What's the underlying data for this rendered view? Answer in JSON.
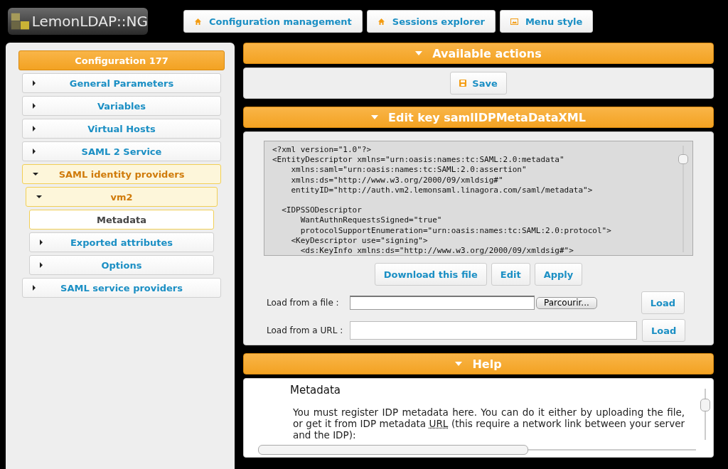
{
  "logo": {
    "text": "LemonLDAP::NG"
  },
  "nav": [
    {
      "label": "Configuration management",
      "kind": "home"
    },
    {
      "label": "Sessions explorer",
      "kind": "home"
    },
    {
      "label": "Menu style",
      "kind": "image"
    }
  ],
  "tree": {
    "title": "Configuration 177",
    "items": [
      {
        "label": "General Parameters",
        "expanded": false,
        "selected": false
      },
      {
        "label": "Variables",
        "expanded": false,
        "selected": false
      },
      {
        "label": "Virtual Hosts",
        "expanded": false,
        "selected": false
      },
      {
        "label": "SAML 2 Service",
        "expanded": false,
        "selected": false
      },
      {
        "label": "SAML identity providers",
        "expanded": true,
        "selected": false,
        "children": [
          {
            "label": "vm2",
            "expanded": true,
            "selected": false,
            "children": [
              {
                "label": "Metadata",
                "kind": "leaf",
                "selected": true
              },
              {
                "label": "Exported attributes",
                "expanded": false,
                "selected": false
              },
              {
                "label": "Options",
                "expanded": false,
                "selected": false
              }
            ]
          }
        ]
      },
      {
        "label": "SAML service providers",
        "expanded": false,
        "selected": false
      }
    ]
  },
  "actions": {
    "title": "Available actions",
    "buttons": [
      "Save"
    ]
  },
  "editor": {
    "title": "Edit key samlIDPMetaDataXML",
    "code": "<?xml version=\"1.0\"?>\n<EntityDescriptor xmlns=\"urn:oasis:names:tc:SAML:2.0:metadata\"\n    xmlns:saml=\"urn:oasis:names:tc:SAML:2.0:assertion\"\n    xmlns:ds=\"http://www.w3.org/2000/09/xmldsig#\"\n    entityID=\"http://auth.vm2.lemonsaml.linagora.com/saml/metadata\">\n\n  <IDPSSODescriptor\n      WantAuthnRequestsSigned=\"true\"\n      protocolSupportEnumeration=\"urn:oasis:names:tc:SAML:2.0:protocol\">\n    <KeyDescriptor use=\"signing\">\n      <ds:KeyInfo xmlns:ds=\"http://www.w3.org/2000/09/xmldsig#\">",
    "buttons": [
      "Download this file",
      "Edit",
      "Apply"
    ],
    "file_label": "Load from a file :",
    "browse": "Parcourir...",
    "load_file": "Load",
    "url_label": "Load from a URL :",
    "load_url": "Load"
  },
  "help": {
    "title": "Help",
    "heading": "Metadata",
    "text_before": "You must register IDP metadata here. You can do it either by uploading the file, or get it from IDP metadata ",
    "abbr": "URL",
    "text_after": " (this require a network link between your server and the IDP):"
  }
}
